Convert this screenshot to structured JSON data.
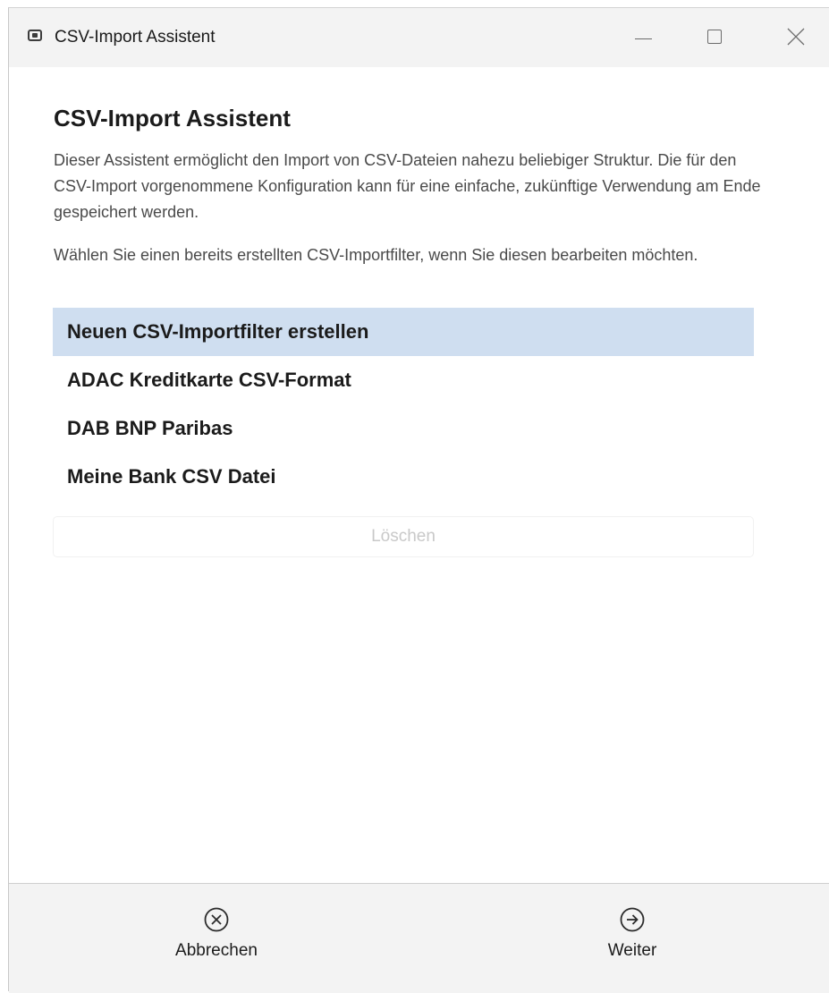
{
  "window": {
    "title": "CSV-Import Assistent",
    "controls": {
      "minimize_icon": "minimize-icon",
      "maximize_icon": "maximize-icon",
      "close_icon": "close-icon"
    }
  },
  "main": {
    "heading": "CSV-Import Assistent",
    "description": "Dieser Assistent ermöglicht den Import von CSV-Dateien nahezu beliebiger Struktur. Die für den CSV-Import vorgenommene Konfiguration kann für eine einfache, zukünftige Verwendung am Ende gespeichert werden.",
    "instruction": "Wählen Sie einen bereits erstellten CSV-Importfilter, wenn Sie diesen bearbeiten möchten.",
    "filters": [
      {
        "label": "Neuen CSV-Importfilter erstellen",
        "selected": true
      },
      {
        "label": "ADAC Kreditkarte CSV-Format",
        "selected": false
      },
      {
        "label": "DAB BNP Paribas",
        "selected": false
      },
      {
        "label": "Meine Bank CSV Datei",
        "selected": false
      }
    ],
    "delete_label": "Löschen",
    "delete_enabled": false
  },
  "footer": {
    "cancel_label": "Abbrechen",
    "cancel_icon": "circle-x-icon",
    "next_label": "Weiter",
    "next_icon": "circle-arrow-right-icon"
  },
  "colors": {
    "selection": "#cfdef0",
    "titlebar": "#f3f3f3",
    "footer": "#f3f3f3"
  }
}
